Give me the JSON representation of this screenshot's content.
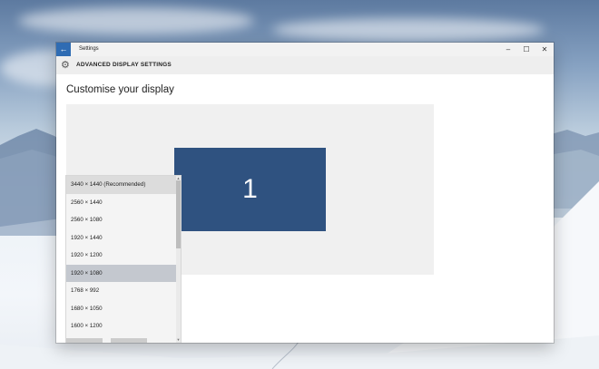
{
  "window": {
    "back_icon": "arrow-left-icon",
    "app_title": "Settings",
    "minimize_glyph": "–",
    "maximize_glyph": "☐",
    "close_glyph": "✕"
  },
  "header": {
    "icon": "gear-icon",
    "title": "ADVANCED DISPLAY SETTINGS"
  },
  "page": {
    "title": "Customise your display"
  },
  "display_preview": {
    "monitor_label": "1",
    "monitor_color": "#2f5280"
  },
  "resolution_dropdown": {
    "options": [
      "3440 × 1440 (Recommended)",
      "2560 × 1440",
      "2560 × 1080",
      "1920 × 1440",
      "1920 × 1200",
      "1920 × 1080",
      "1768 × 992",
      "1680 × 1050",
      "1600 × 1200"
    ],
    "selected": "1920 × 1080"
  },
  "colors": {
    "accent": "#2f6cb3",
    "selected_row": "#c4c8cf"
  }
}
